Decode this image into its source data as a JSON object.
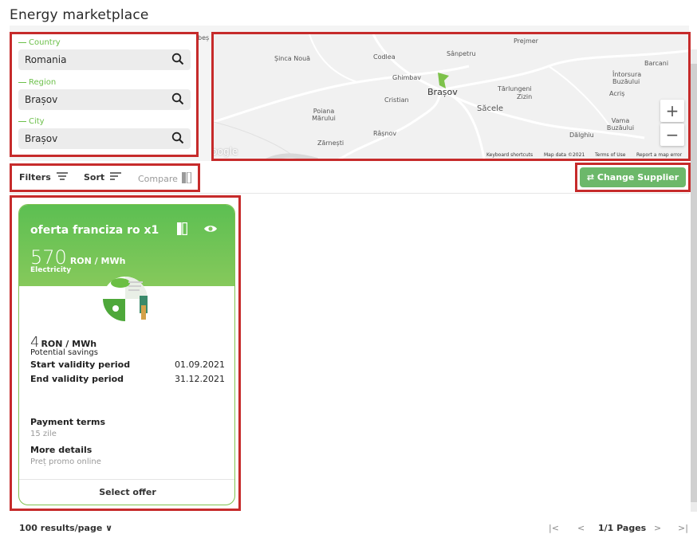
{
  "page": {
    "title": "Energy marketplace"
  },
  "filters": {
    "country": {
      "label": "Country",
      "value": "Romania"
    },
    "region": {
      "label": "Region",
      "value": "Brașov"
    },
    "city": {
      "label": "City",
      "value": "Brașov"
    }
  },
  "map": {
    "edge_text": "beș",
    "labels": [
      "Șinca Nouă",
      "Codlea",
      "Sânpetru",
      "Prejmer",
      "Barcani",
      "Ghimbav",
      "Întorsura Buzăului",
      "Tărlungeni",
      "Zizin",
      "Cristian",
      "Acriș",
      "Poiana Mărului",
      "Săcele",
      "Vama Buzăului",
      "Dălghiu",
      "Râșnov",
      "Zărnești"
    ],
    "city_main": "Brașov",
    "zoom_in": "+",
    "zoom_out": "−",
    "brand": "Google",
    "footer": {
      "shortcuts": "Keyboard shortcuts",
      "data": "Map data ©2021",
      "terms": "Terms of Use",
      "report": "Report a map error"
    }
  },
  "toolbar": {
    "filters_label": "Filters",
    "sort_label": "Sort",
    "compare_label": "Compare",
    "change_supplier_label": "⇄ Change Supplier"
  },
  "offer": {
    "title": "oferta franciza ro x1",
    "price": "570",
    "price_unit": "RON / MWh",
    "energy_type": "Electricity",
    "savings_value": "4",
    "savings_unit": "RON / MWh",
    "savings_label": "Potential savings",
    "start_label": "Start validity period",
    "start_value": "01.09.2021",
    "end_label": "End validity period",
    "end_value": "31.12.2021",
    "payment_title": "Payment terms",
    "payment_text": "15 zile",
    "details_title": "More details",
    "details_text": "Preț promo online",
    "select_label": "Select offer"
  },
  "pagination": {
    "per_page": "100 results/page ∨",
    "first": "|<",
    "prev": "<",
    "pages_text": "1/1 Pages",
    "next": ">",
    "last": ">|"
  },
  "colors": {
    "accent_green": "#6cb86a",
    "highlight_red": "#c62b2b",
    "label_green": "#6cc04a"
  }
}
